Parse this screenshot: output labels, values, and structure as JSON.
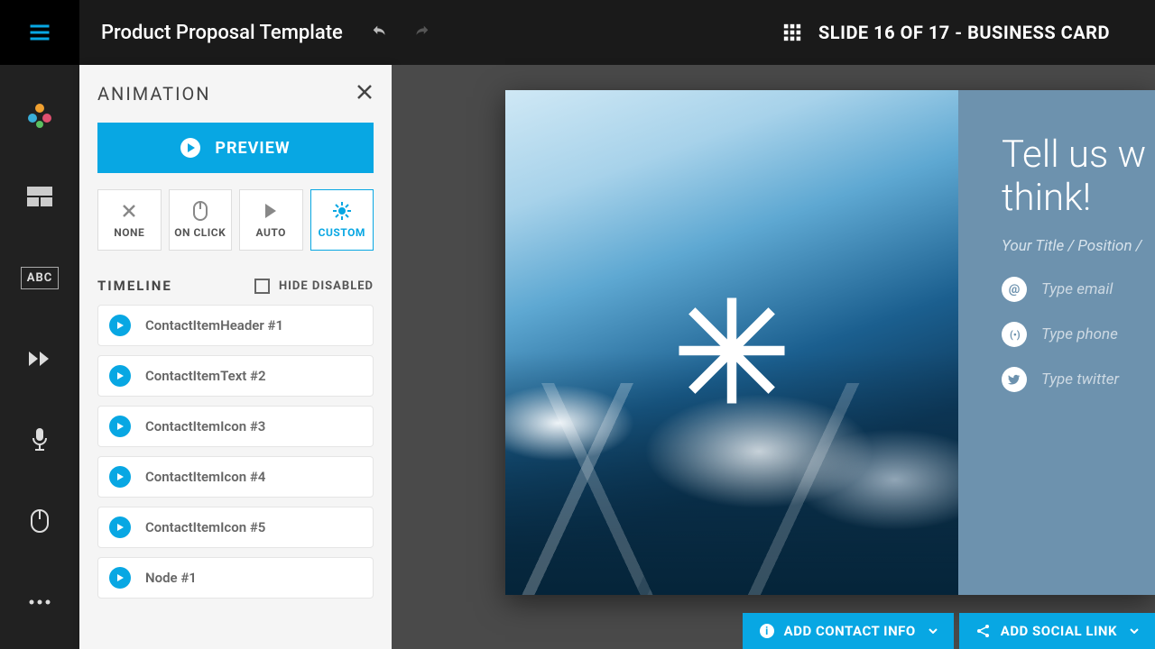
{
  "header": {
    "doc_title": "Product Proposal Template",
    "slide_info": "SLIDE 16 OF 17 - BUSINESS CARD"
  },
  "leftrail": {
    "abc": "ABC"
  },
  "panel": {
    "title": "ANIMATION",
    "preview_label": "PREVIEW",
    "modes": [
      {
        "label": "NONE"
      },
      {
        "label": "ON CLICK"
      },
      {
        "label": "AUTO"
      },
      {
        "label": "CUSTOM"
      }
    ],
    "timeline_title": "TIMELINE",
    "hide_disabled_label": "HIDE DISABLED",
    "items": [
      "ContactItemHeader #1",
      "ContactItemText #2",
      "ContactItemIcon #3",
      "ContactItemIcon #4",
      "ContactItemIcon #5",
      "Node #1"
    ]
  },
  "slide": {
    "headline1": "Tell us w",
    "headline2": "think!",
    "subtitle": "Your Title / Position /",
    "email_placeholder": "Type email",
    "phone_placeholder": "Type phone",
    "twitter_placeholder": "Type twitter"
  },
  "actions": {
    "add_contact": "ADD CONTACT INFO",
    "add_social": "ADD SOCIAL LINK"
  }
}
